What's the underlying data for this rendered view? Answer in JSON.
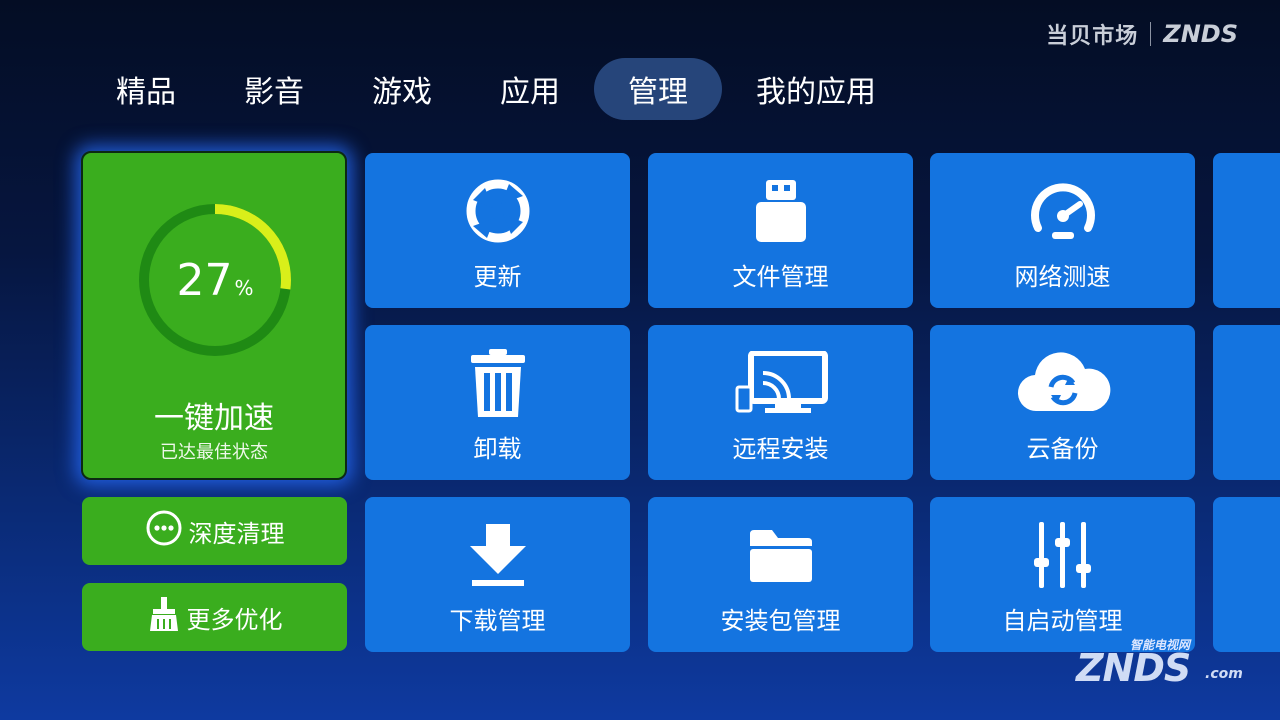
{
  "brand": {
    "cn": "当贝市场",
    "en": "ZNDS"
  },
  "nav": {
    "tabs": [
      {
        "label": "精品"
      },
      {
        "label": "影音"
      },
      {
        "label": "游戏"
      },
      {
        "label": "应用"
      },
      {
        "label": "管理",
        "active": true
      },
      {
        "label": "我的应用"
      }
    ]
  },
  "accelerate": {
    "percent": "27",
    "percent_unit": "%",
    "title": "一键加速",
    "subtitle": "已达最佳状态",
    "gauge_fraction": 0.27
  },
  "side_buttons": {
    "deep_clean": "深度清理",
    "more_optimize": "更多优化"
  },
  "tiles": [
    {
      "label": "更新",
      "icon": "refresh-icon"
    },
    {
      "label": "文件管理",
      "icon": "usb-drive-icon"
    },
    {
      "label": "网络测速",
      "icon": "speedometer-icon"
    },
    {
      "label": "卸载",
      "icon": "trash-icon"
    },
    {
      "label": "远程安装",
      "icon": "cast-screen-icon"
    },
    {
      "label": "云备份",
      "icon": "cloud-sync-icon"
    },
    {
      "label": "下载管理",
      "icon": "download-icon"
    },
    {
      "label": "安装包管理",
      "icon": "folder-icon"
    },
    {
      "label": "自启动管理",
      "icon": "sliders-icon"
    }
  ],
  "watermark": {
    "top": "智能电视网",
    "main": "ZNDS",
    "suffix": ".com"
  },
  "colors": {
    "green": "#3aad1e",
    "tile_blue": "#1474e0",
    "active_tab": "#26457a",
    "gauge_arc": "#d9ef1a"
  }
}
